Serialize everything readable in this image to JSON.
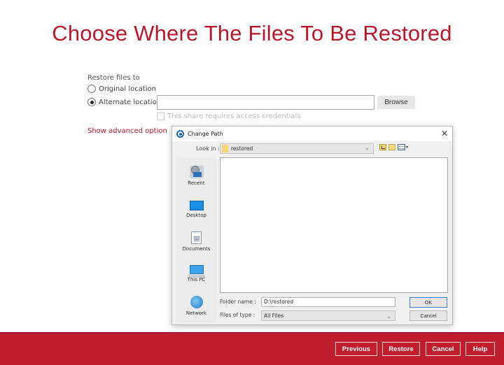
{
  "page": {
    "title": "Choose Where The Files To Be Restored",
    "restore_label": "Restore files to",
    "options": [
      {
        "label": "Original location",
        "checked": false
      },
      {
        "label": "Alternate location",
        "checked": true
      }
    ],
    "path_value": "",
    "browse_label": "Browse",
    "credentials_label": "This share requires access credentials",
    "advanced_link": "Show advanced option"
  },
  "dialog": {
    "title": "Change Path",
    "close_glyph": "✕",
    "look_in_label": "Look in :",
    "look_in_value": "restored",
    "places": [
      "Recent",
      "Desktop",
      "Documents",
      "This PC",
      "Network"
    ],
    "folder_name_label": "Folder name :",
    "folder_name_value": "D:\\restored",
    "files_of_type_label": "Files of type :",
    "files_of_type_value": "All Files",
    "ok_label": "OK",
    "cancel_label": "Cancel",
    "chevron": "⌄"
  },
  "footer": {
    "buttons": [
      "Previous",
      "Restore",
      "Cancel",
      "Help"
    ]
  },
  "colors": {
    "brand": "#c01e2e",
    "title": "#b7182b"
  }
}
